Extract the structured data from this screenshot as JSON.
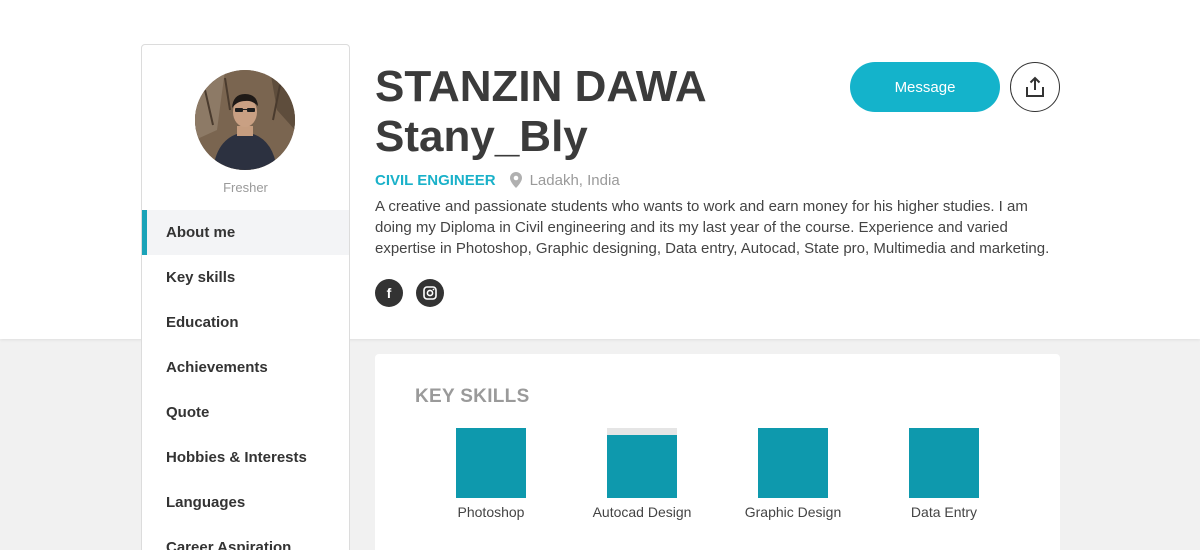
{
  "profile": {
    "name": "STANZIN DAWA",
    "username": "Stany_Bly",
    "role": "CIVIL ENGINEER",
    "location": "Ladakh, India",
    "level": "Fresher",
    "bio": "A creative and passionate students who wants to work and earn money for his higher studies. I am doing my Diploma in Civil engineering and its my last year of the course. Experience and varied expertise in Photoshop, Graphic designing, Data entry, Autocad, State pro, Multimedia and marketing."
  },
  "actions": {
    "message_label": "Message",
    "share_icon": "share-icon"
  },
  "social": [
    {
      "icon": "facebook-icon",
      "glyph": "f"
    },
    {
      "icon": "instagram-icon"
    }
  ],
  "sidebar": {
    "items": [
      {
        "label": "About me",
        "active": true
      },
      {
        "label": "Key skills",
        "active": false
      },
      {
        "label": "Education",
        "active": false
      },
      {
        "label": "Achievements",
        "active": false
      },
      {
        "label": "Quote",
        "active": false
      },
      {
        "label": "Hobbies & Interests",
        "active": false
      },
      {
        "label": "Languages",
        "active": false
      },
      {
        "label": "Career Aspiration",
        "active": false
      }
    ]
  },
  "skills": {
    "title": "KEY SKILLS",
    "items": [
      {
        "label": "Photoshop",
        "level": 1.0
      },
      {
        "label": "Autocad Design",
        "level": 0.9
      },
      {
        "label": "Graphic Design",
        "level": 1.0
      },
      {
        "label": "Data Entry",
        "level": 1.0
      }
    ]
  },
  "colors": {
    "accent": "#14b3cb",
    "role": "#1ab1c9",
    "skill_fill": "#0e99ad",
    "skill_track": "#e5e5e5",
    "background": "#f1f1f1"
  }
}
